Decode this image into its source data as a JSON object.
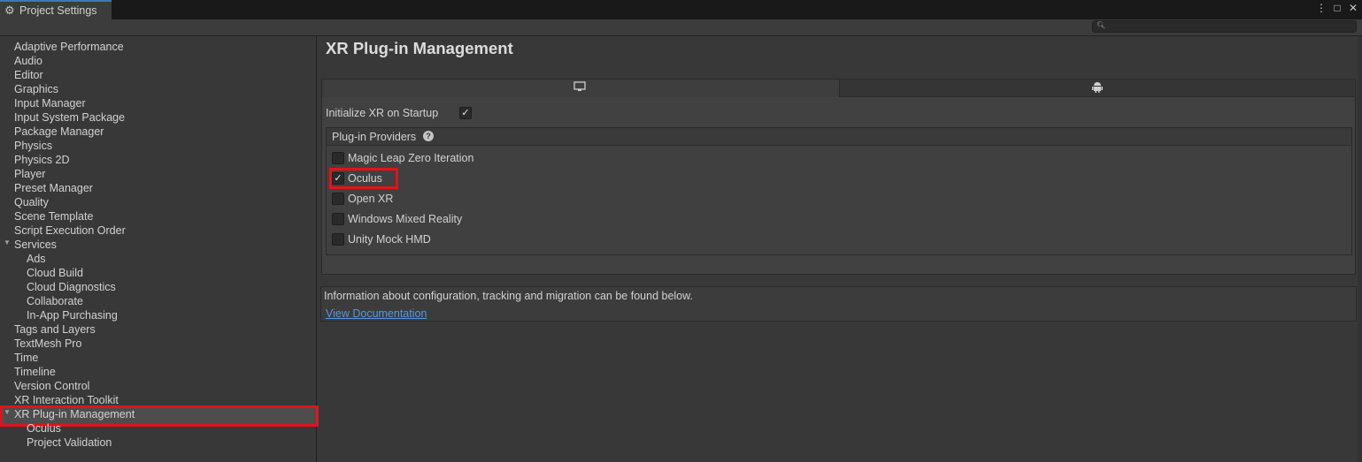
{
  "window": {
    "tab_title": "Project Settings",
    "tab_icon": "gear-icon",
    "buttons": [
      "⋮",
      "□",
      "✕"
    ]
  },
  "search": {
    "placeholder": ""
  },
  "sidebar": {
    "items": [
      {
        "label": "Adaptive Performance",
        "indent": 0
      },
      {
        "label": "Audio",
        "indent": 0
      },
      {
        "label": "Editor",
        "indent": 0
      },
      {
        "label": "Graphics",
        "indent": 0
      },
      {
        "label": "Input Manager",
        "indent": 0
      },
      {
        "label": "Input System Package",
        "indent": 0
      },
      {
        "label": "Package Manager",
        "indent": 0
      },
      {
        "label": "Physics",
        "indent": 0
      },
      {
        "label": "Physics 2D",
        "indent": 0
      },
      {
        "label": "Player",
        "indent": 0
      },
      {
        "label": "Preset Manager",
        "indent": 0
      },
      {
        "label": "Quality",
        "indent": 0
      },
      {
        "label": "Scene Template",
        "indent": 0
      },
      {
        "label": "Script Execution Order",
        "indent": 0
      },
      {
        "label": "Services",
        "indent": 0,
        "expanded": true
      },
      {
        "label": "Ads",
        "indent": 1
      },
      {
        "label": "Cloud Build",
        "indent": 1
      },
      {
        "label": "Cloud Diagnostics",
        "indent": 1
      },
      {
        "label": "Collaborate",
        "indent": 1
      },
      {
        "label": "In-App Purchasing",
        "indent": 1
      },
      {
        "label": "Tags and Layers",
        "indent": 0
      },
      {
        "label": "TextMesh Pro",
        "indent": 0
      },
      {
        "label": "Time",
        "indent": 0
      },
      {
        "label": "Timeline",
        "indent": 0
      },
      {
        "label": "Version Control",
        "indent": 0
      },
      {
        "label": "XR Interaction Toolkit",
        "indent": 0
      },
      {
        "label": "XR Plug-in Management",
        "indent": 0,
        "expanded": true,
        "selected": true
      },
      {
        "label": "Oculus",
        "indent": 1
      },
      {
        "label": "Project Validation",
        "indent": 1
      }
    ]
  },
  "main": {
    "title": "XR Plug-in Management",
    "platform_tabs": [
      {
        "name": "desktop",
        "icon": "monitor-icon",
        "active": true
      },
      {
        "name": "android",
        "icon": "android-icon",
        "active": false
      }
    ],
    "initialize_label": "Initialize XR on Startup",
    "initialize_checked": true,
    "providers_title": "Plug-in Providers",
    "providers": [
      {
        "label": "Magic Leap Zero Iteration",
        "checked": false
      },
      {
        "label": "Oculus",
        "checked": true,
        "highlighted": true
      },
      {
        "label": "Open XR",
        "checked": false
      },
      {
        "label": "Windows Mixed Reality",
        "checked": false
      },
      {
        "label": "Unity Mock HMD",
        "checked": false
      }
    ],
    "info_text": "Information about configuration, tracking and migration can be found below.",
    "doc_link": "View Documentation"
  },
  "colors": {
    "highlight": "#e3121b",
    "link": "#5996e3",
    "background": "#383838"
  }
}
